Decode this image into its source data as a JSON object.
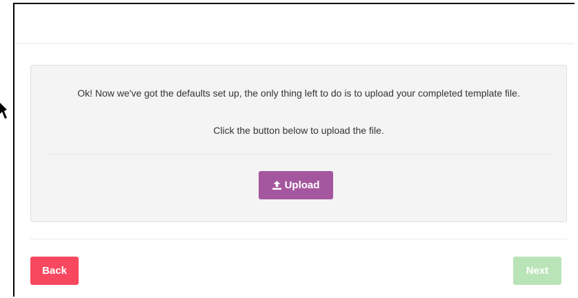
{
  "panel": {
    "message": "Ok! Now we've got the defaults set up, the only thing left to do is to upload your completed template file.",
    "instruction": "Click the button below to upload the file.",
    "upload_label": "Upload",
    "upload_icon": "upload-icon"
  },
  "footer": {
    "back_label": "Back",
    "next_label": "Next",
    "next_disabled": true
  },
  "colors": {
    "upload": "#a4579e",
    "back": "#f7485f",
    "next_disabled": "#b9e4b8",
    "panel_bg": "#f4f4f4"
  }
}
